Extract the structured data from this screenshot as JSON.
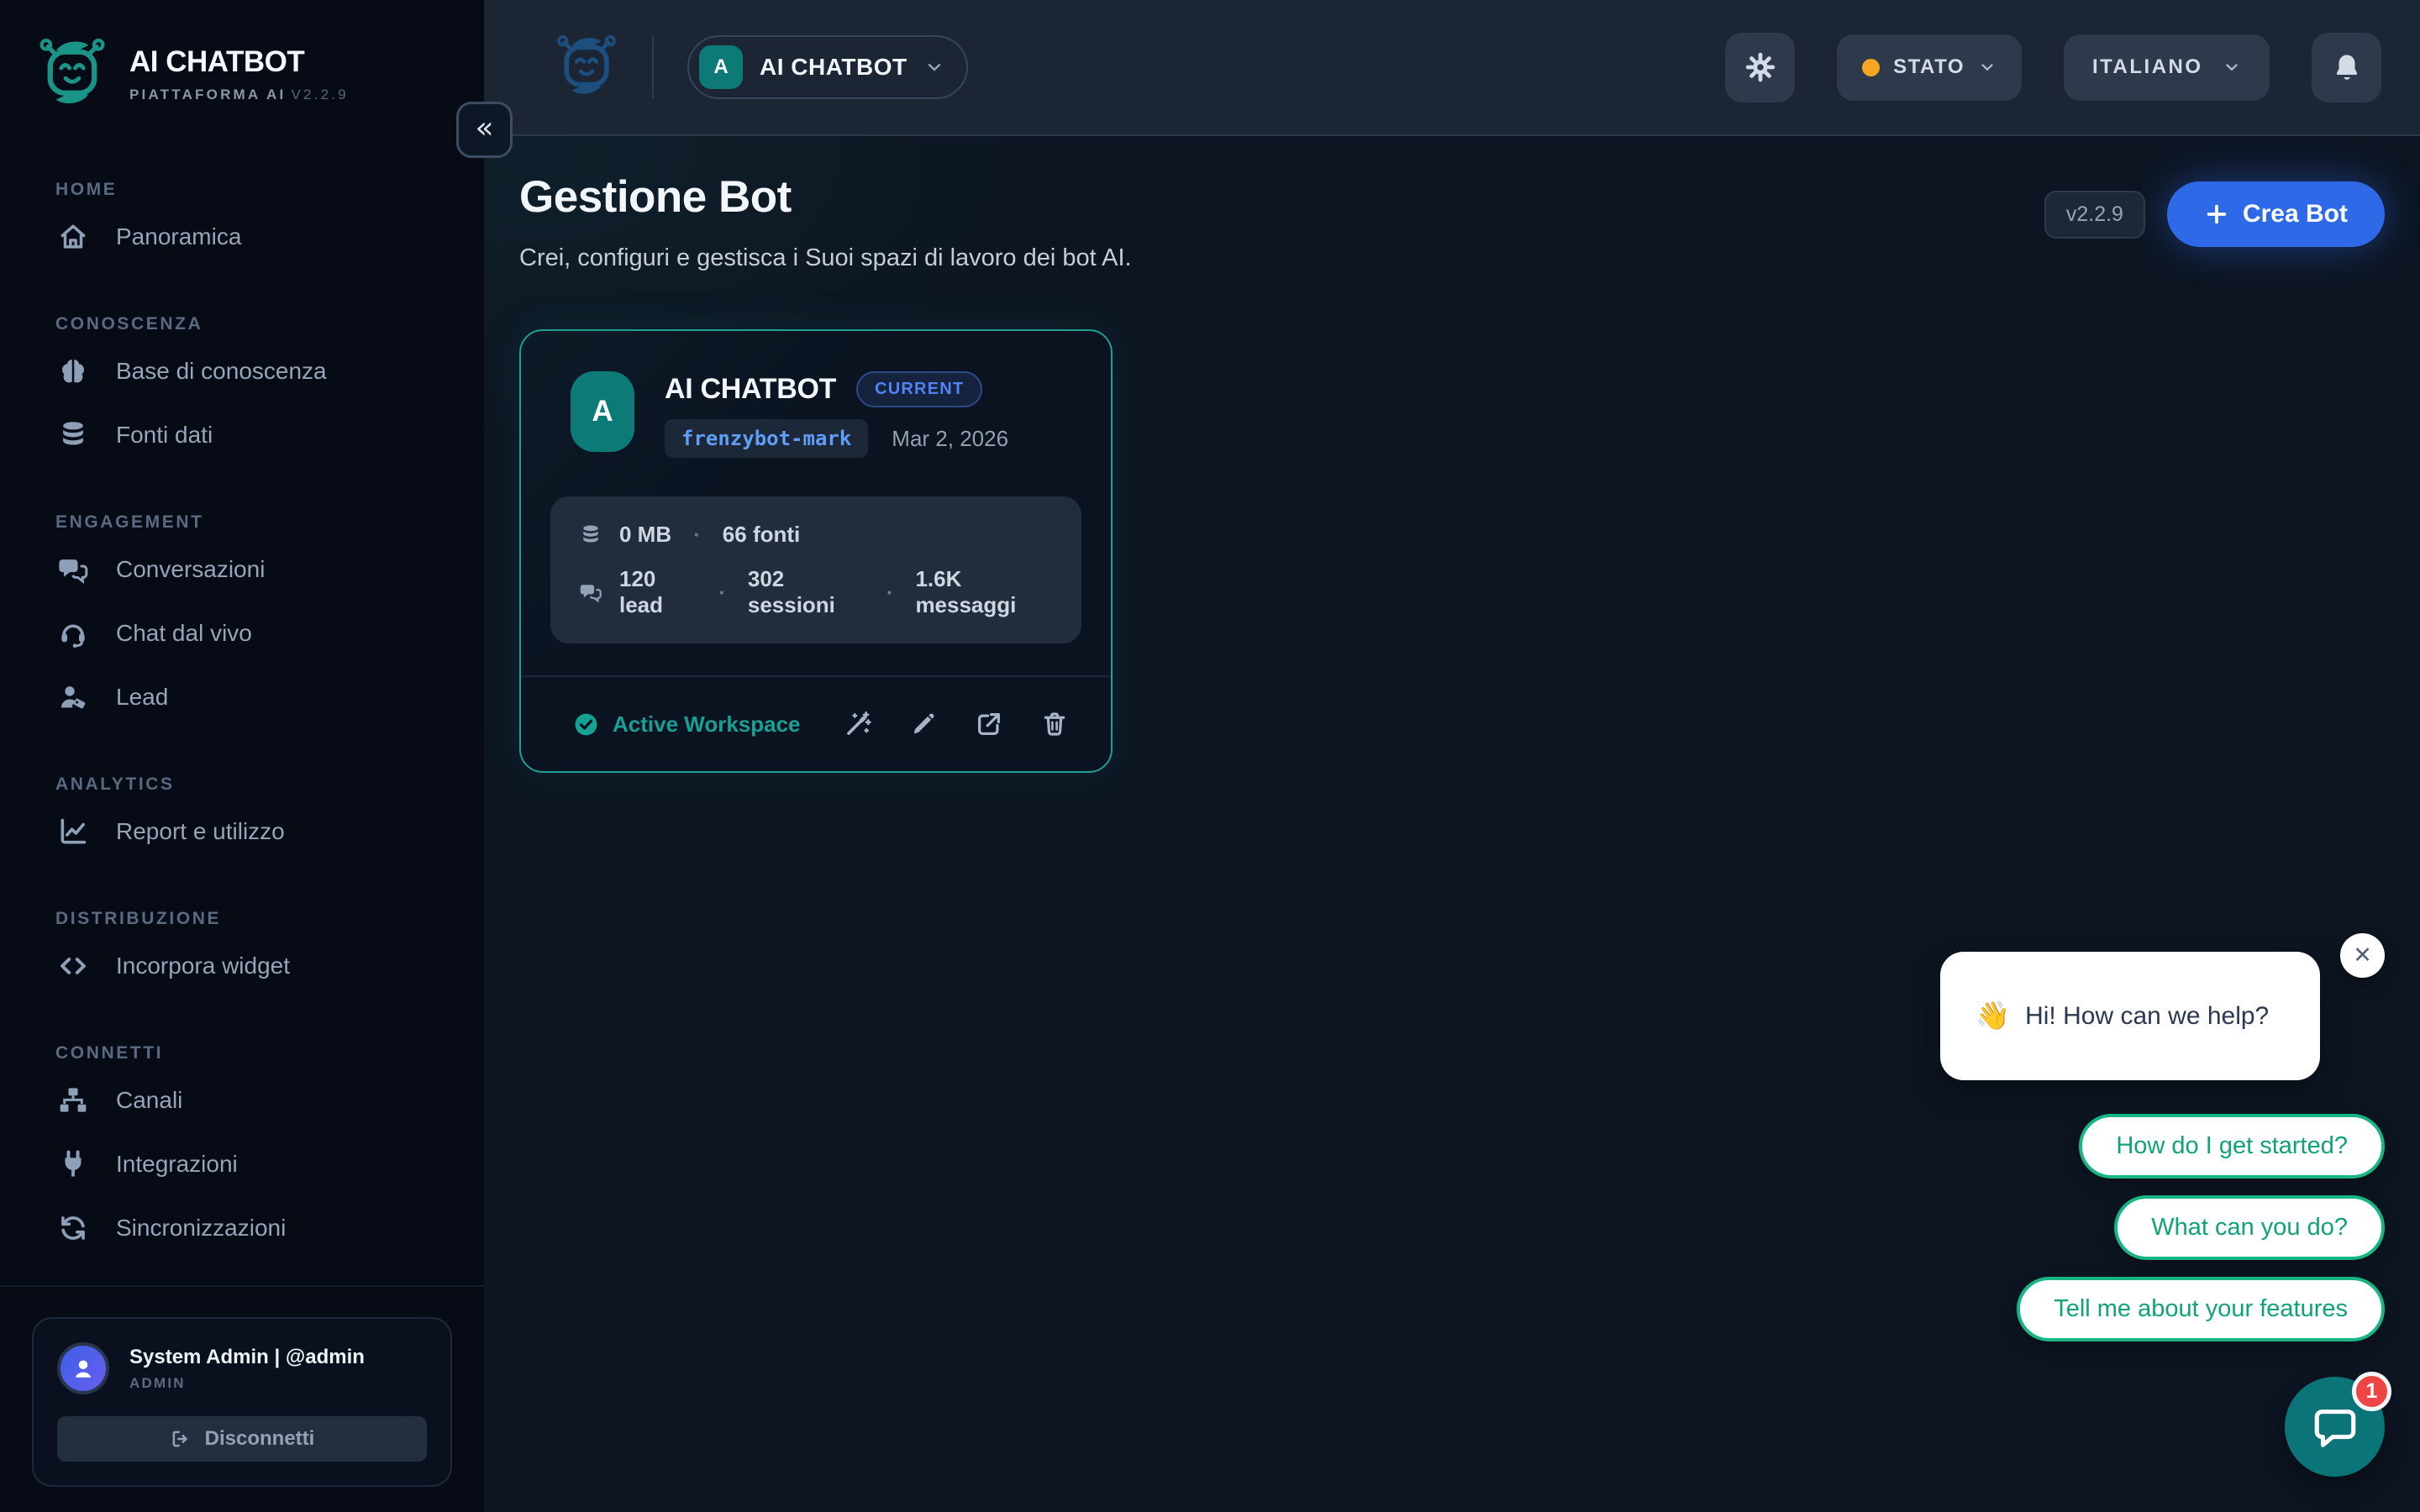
{
  "brand": {
    "name": "AI CHATBOT",
    "subtitle": "PIATTAFORMA AI",
    "version": "V2.2.9"
  },
  "sidebar": {
    "collapse_glyph": "«",
    "sections": [
      {
        "label": "HOME",
        "items": [
          {
            "label": "Panoramica"
          }
        ]
      },
      {
        "label": "CONOSCENZA",
        "items": [
          {
            "label": "Base di conoscenza"
          },
          {
            "label": "Fonti dati"
          }
        ]
      },
      {
        "label": "ENGAGEMENT",
        "items": [
          {
            "label": "Conversazioni"
          },
          {
            "label": "Chat dal vivo"
          },
          {
            "label": "Lead"
          }
        ]
      },
      {
        "label": "ANALYTICS",
        "items": [
          {
            "label": "Report e utilizzo"
          }
        ]
      },
      {
        "label": "DISTRIBUZIONE",
        "items": [
          {
            "label": "Incorpora widget"
          }
        ]
      },
      {
        "label": "CONNETTI",
        "items": [
          {
            "label": "Canali"
          },
          {
            "label": "Integrazioni"
          },
          {
            "label": "Sincronizzazioni"
          }
        ]
      }
    ]
  },
  "user_panel": {
    "name": "System Admin | @admin",
    "role": "ADMIN",
    "logout_label": "Disconnetti"
  },
  "topbar": {
    "workspace": {
      "initial": "A",
      "name": "AI CHATBOT"
    },
    "status_label": "STATO",
    "language_label": "ITALIANO"
  },
  "page": {
    "title": "Gestione Bot",
    "subtitle": "Crei, configuri e gestisca i Suoi spazi di lavoro dei bot AI.",
    "version_badge": "v2.2.9",
    "create_button": "Crea Bot"
  },
  "workspace_card": {
    "initial": "A",
    "name": "AI CHATBOT",
    "badge": "CURRENT",
    "slug": "frenzybot-mark",
    "date": "Mar 2, 2026",
    "storage": "0 MB",
    "sources": "66 fonti",
    "leads": "120 lead",
    "sessions": "302 sessioni",
    "messages": "1.6K messaggi",
    "separator": "·",
    "status": "Active Workspace"
  },
  "chat_widget": {
    "greeting_emoji": "👋",
    "greeting": "Hi! How can we help?",
    "close": "✕",
    "suggestions": [
      "How do I get started?",
      "What can you do?",
      "Tell me about your features"
    ],
    "unread_count": "1"
  },
  "colors": {
    "accent_teal": "#1f9e92",
    "accent_blue": "#2e69e8",
    "suggestion_green": "#17b583",
    "status_yellow": "#f5a623",
    "badge_red": "#ee4444"
  }
}
